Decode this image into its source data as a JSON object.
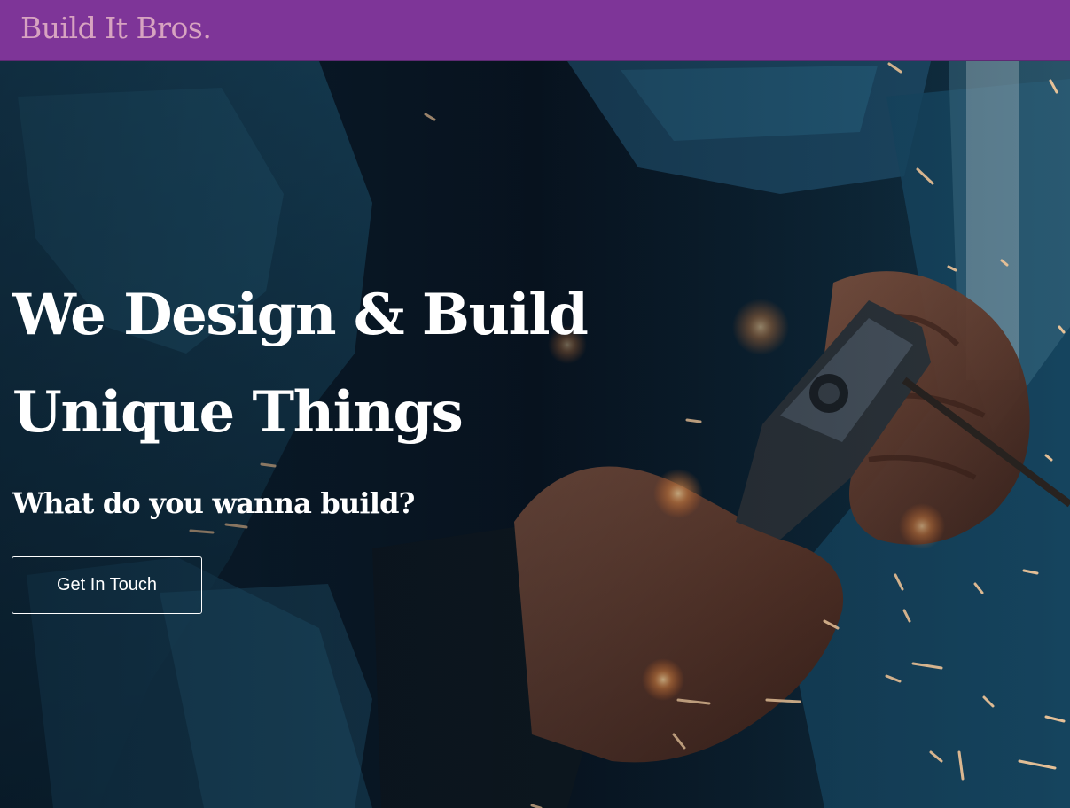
{
  "header": {
    "brand": "Build It Bros."
  },
  "hero": {
    "title_line_1": "We Design & Build",
    "title_line_2": "Unique Things",
    "subtitle": "What do you wanna build?",
    "cta_label": "Get In Touch"
  },
  "colors": {
    "nav_background": "#7e3598",
    "brand_text": "#d7a3c0",
    "hero_text": "#ffffff"
  }
}
